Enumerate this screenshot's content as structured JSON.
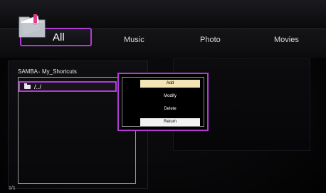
{
  "tabs": {
    "all": "All",
    "music": "Music",
    "photo": "Photo",
    "movies": "Movies"
  },
  "breadcrumb": {
    "root": "SAMBA",
    "folder": "My_Shortcuts"
  },
  "list": {
    "items": [
      "/../"
    ]
  },
  "page_indicator": "1/1",
  "context_menu": {
    "add": "Add",
    "modify": "Modify",
    "delete": "Delete",
    "return": "Return"
  },
  "colors": {
    "highlight": "#b23bd6",
    "selected_menu_item": "#f3e6b6"
  }
}
